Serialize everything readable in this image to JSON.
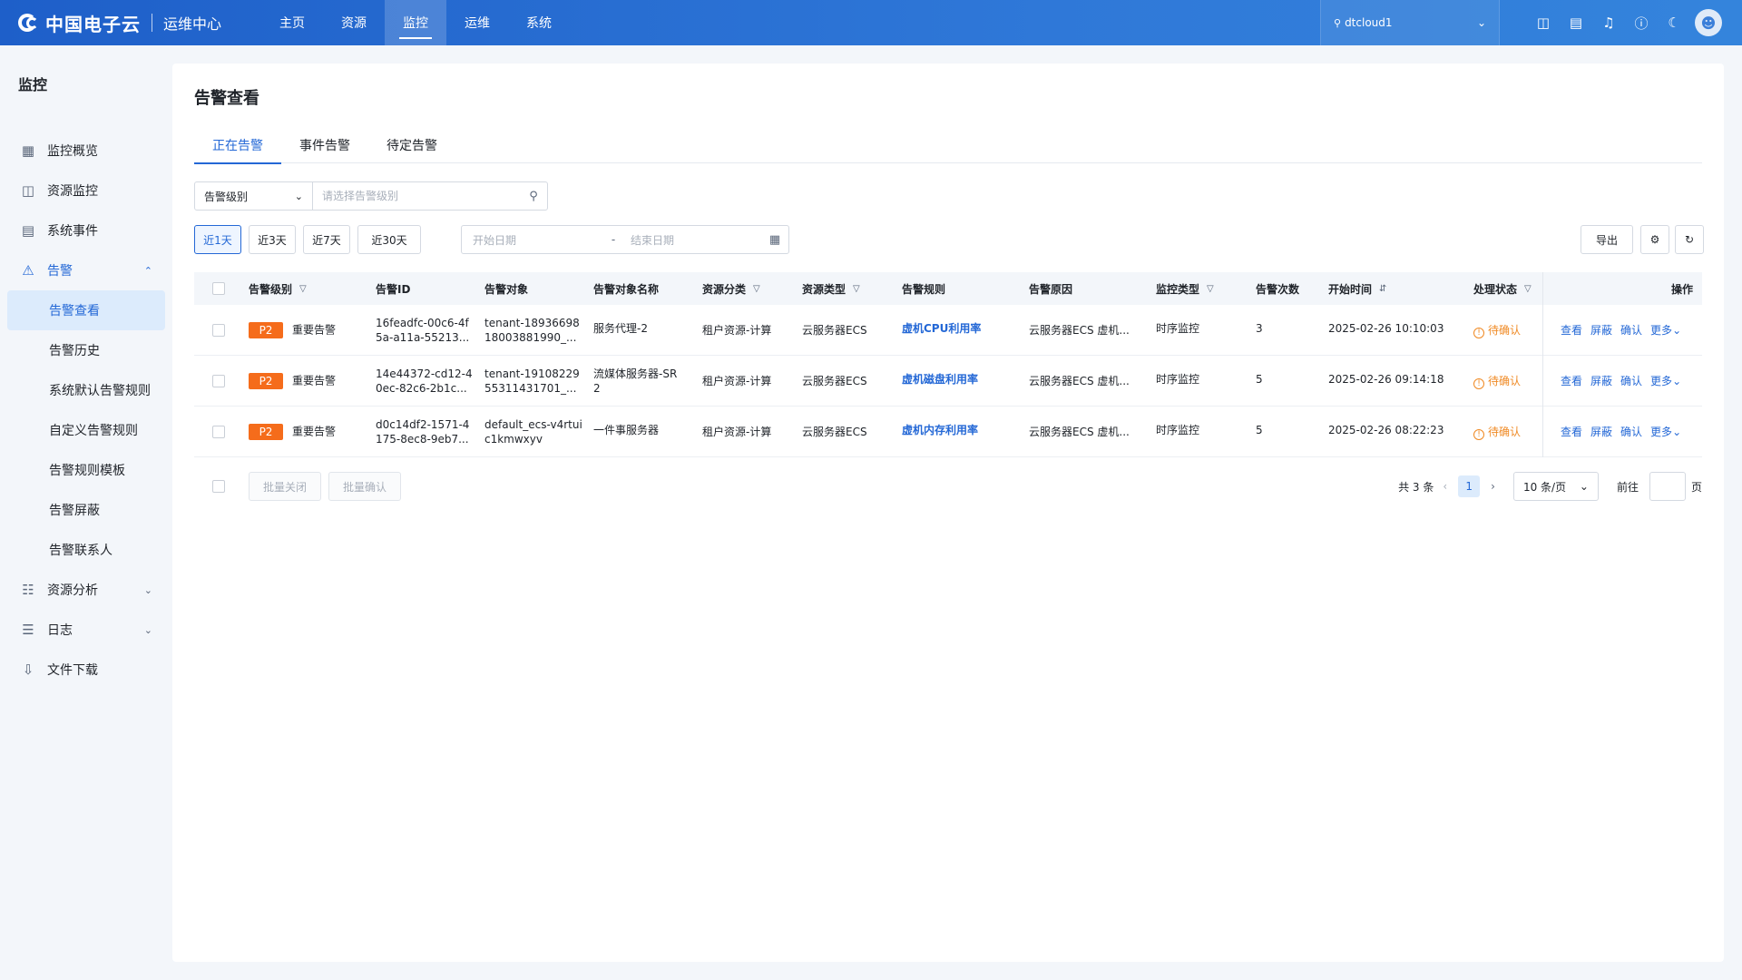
{
  "header": {
    "logo_text": "中国电子云",
    "logo_sub": "运维中心",
    "nav": [
      "主页",
      "资源",
      "监控",
      "运维",
      "系统"
    ],
    "tenant": "dtcloud1"
  },
  "sidebar": {
    "title": "监控",
    "items": [
      {
        "label": "监控概览",
        "icon": "grid-icon"
      },
      {
        "label": "资源监控",
        "icon": "monitor-icon"
      },
      {
        "label": "系统事件",
        "icon": "event-icon"
      },
      {
        "label": "告警",
        "icon": "alarm-icon"
      },
      {
        "label": "告警查看"
      },
      {
        "label": "告警历史"
      },
      {
        "label": "系统默认告警规则"
      },
      {
        "label": "自定义告警规则"
      },
      {
        "label": "告警规则模板"
      },
      {
        "label": "告警屏蔽"
      },
      {
        "label": "告警联系人"
      },
      {
        "label": "资源分析",
        "icon": "analysis-icon"
      },
      {
        "label": "日志",
        "icon": "log-icon"
      },
      {
        "label": "文件下载",
        "icon": "download-icon"
      }
    ]
  },
  "main": {
    "title": "告警查看",
    "tabs": [
      "正在告警",
      "事件告警",
      "待定告警"
    ],
    "filter": {
      "select": "告警级别",
      "placeholder": "请选择告警级别"
    },
    "quick": [
      "近1天",
      "近3天",
      "近7天",
      "近30天"
    ],
    "date": {
      "start": "开始日期",
      "sep": "-",
      "end": "结束日期"
    },
    "export": "导出"
  },
  "table": {
    "columns": [
      "告警级别",
      "告警ID",
      "告警对象",
      "告警对象名称",
      "资源分类",
      "资源类型",
      "告警规则",
      "告警原因",
      "监控类型",
      "告警次数",
      "开始时间",
      "处理状态",
      "操作"
    ],
    "rows": [
      {
        "level": "P2",
        "level_text": "重要告警",
        "id": [
          "16feadfc-00c6-4f",
          "5a-a11a-55213..."
        ],
        "target": [
          "tenant-18936698",
          "18003881990_..."
        ],
        "target_name": [
          "服务代理-2",
          ""
        ],
        "category": "租户资源-计算",
        "type": "云服务器ECS",
        "rule": "虚机CPU利用率",
        "reason": "云服务器ECS 虚机...",
        "monitor": "时序监控",
        "count": "3",
        "start": "2025-02-26 10:10:03",
        "status": "待确认"
      },
      {
        "level": "P2",
        "level_text": "重要告警",
        "id": [
          "14e44372-cd12-4",
          "0ec-82c6-2b1c..."
        ],
        "target": [
          "tenant-19108229",
          "55311431701_..."
        ],
        "target_name": [
          "流媒体服务器-SR",
          "2"
        ],
        "category": "租户资源-计算",
        "type": "云服务器ECS",
        "rule": "虚机磁盘利用率",
        "reason": "云服务器ECS 虚机...",
        "monitor": "时序监控",
        "count": "5",
        "start": "2025-02-26 09:14:18",
        "status": "待确认"
      },
      {
        "level": "P2",
        "level_text": "重要告警",
        "id": [
          "d0c14df2-1571-4",
          "175-8ec8-9eb7..."
        ],
        "target": [
          "default_ecs-v4rtui",
          "c1kmwxyv"
        ],
        "target_name": [
          "一件事服务器",
          ""
        ],
        "category": "租户资源-计算",
        "type": "云服务器ECS",
        "rule": "虚机内存利用率",
        "reason": "云服务器ECS 虚机...",
        "monitor": "时序监控",
        "count": "5",
        "start": "2025-02-26 08:22:23",
        "status": "待确认"
      }
    ],
    "ops": [
      "查看",
      "屏蔽",
      "确认",
      "更多"
    ]
  },
  "footer": {
    "batch_close": "批量关闭",
    "batch_confirm": "批量确认",
    "total": "共 3 条",
    "page": "1",
    "page_size": "10 条/页",
    "goto": "前往",
    "page_unit": "页"
  },
  "colors": {
    "primary": "#2468d6",
    "badge": "#f56c1b",
    "warning": "#f08a24"
  }
}
